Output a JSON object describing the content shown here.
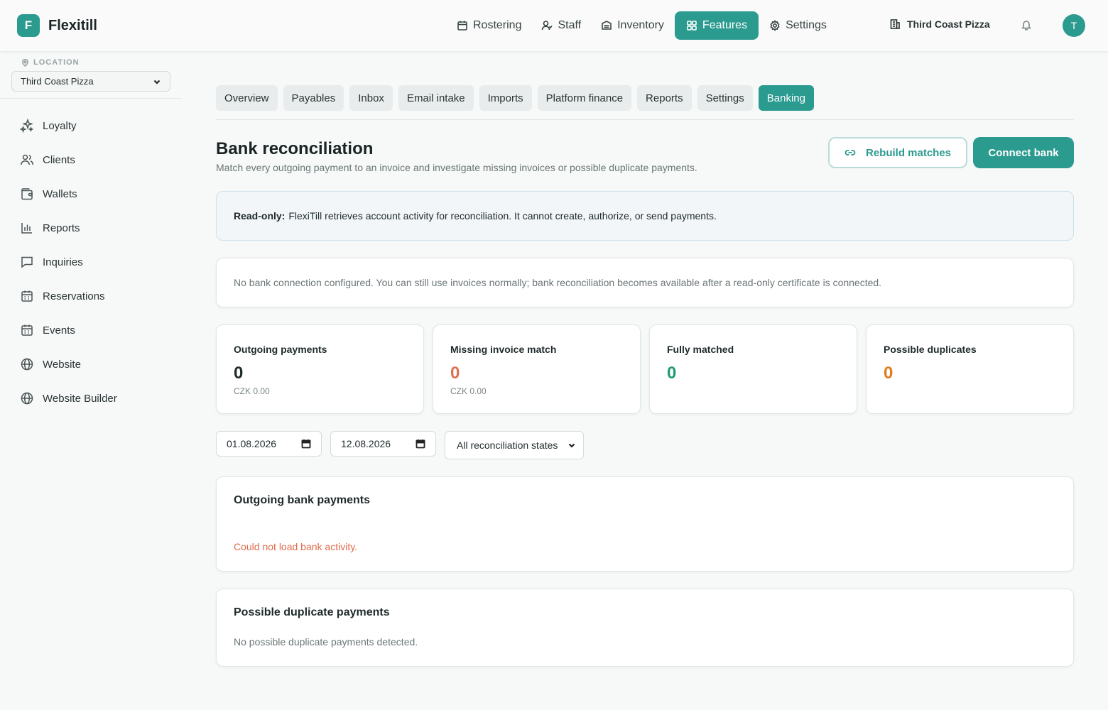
{
  "app": {
    "logo_letter": "F",
    "name": "Flexitill"
  },
  "topnav": {
    "items": [
      {
        "label": "Rostering",
        "icon": "calendar-icon"
      },
      {
        "label": "Staff",
        "icon": "user-icon"
      },
      {
        "label": "Inventory",
        "icon": "box-icon"
      },
      {
        "label": "Features",
        "icon": "grid-icon"
      },
      {
        "label": "Settings",
        "icon": "gear-icon"
      }
    ],
    "active": "Features",
    "location": "Third Coast Pizza",
    "avatar_initial": "T"
  },
  "sidebar": {
    "location_label": "LOCATION",
    "location_value": "Third Coast Pizza",
    "items": [
      {
        "label": "Loyalty",
        "icon": "sparkles-icon"
      },
      {
        "label": "Clients",
        "icon": "users-icon"
      },
      {
        "label": "Wallets",
        "icon": "wallet-icon"
      },
      {
        "label": "Reports",
        "icon": "bar-chart-icon"
      },
      {
        "label": "Inquiries",
        "icon": "message-icon"
      },
      {
        "label": "Reservations",
        "icon": "calendar-icon"
      },
      {
        "label": "Events",
        "icon": "calendar-icon"
      },
      {
        "label": "Website",
        "icon": "globe-icon"
      },
      {
        "label": "Website Builder",
        "icon": "globe-icon"
      }
    ]
  },
  "tabs": {
    "items": [
      "Overview",
      "Payables",
      "Inbox",
      "Email intake",
      "Imports",
      "Platform finance",
      "Reports",
      "Settings",
      "Banking"
    ],
    "active": "Banking"
  },
  "page": {
    "title": "Bank reconciliation",
    "subtitle": "Match every outgoing payment to an invoice and investigate missing invoices or possible duplicate payments.",
    "rebuild_label": "Rebuild matches",
    "connect_label": "Connect bank"
  },
  "notice": {
    "bold": "Read-only:",
    "text": "FlexiTill retrieves account activity for reconciliation. It cannot create, authorize, or send payments."
  },
  "info": "No bank connection configured. You can still use invoices normally; bank reconciliation becomes available after a read-only certificate is connected.",
  "stats": [
    {
      "label": "Outgoing payments",
      "value": "0",
      "sub": "CZK 0.00",
      "color": "#1f2a2b"
    },
    {
      "label": "Missing invoice match",
      "value": "0",
      "sub": "CZK 0.00",
      "color": "#e0704f"
    },
    {
      "label": "Fully matched",
      "value": "0",
      "sub": "",
      "color": "#1f9a72"
    },
    {
      "label": "Possible duplicates",
      "value": "0",
      "sub": "",
      "color": "#e07a1a"
    }
  ],
  "filters": {
    "date_from": "01.08.2026",
    "date_to": "12.08.2026",
    "state": "All reconciliation states"
  },
  "outgoing": {
    "title": "Outgoing bank payments",
    "error": "Could not load bank activity."
  },
  "duplicates": {
    "title": "Possible duplicate payments",
    "empty": "No possible duplicate payments detected."
  },
  "colors": {
    "accent": "#2b9a8f",
    "error": "#e06a4a"
  }
}
